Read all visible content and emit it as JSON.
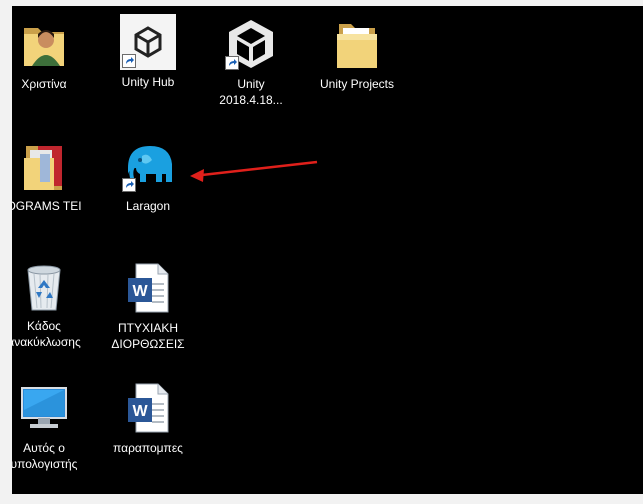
{
  "desktop": {
    "background_color": "#000000",
    "icons": [
      {
        "label": "Χριστίνα",
        "icon": "user-folder-icon"
      },
      {
        "label": "Unity Hub",
        "icon": "unity-hub-icon"
      },
      {
        "label": "Unity 2018.4.18...",
        "icon": "unity-editor-icon"
      },
      {
        "label": "Unity Projects",
        "icon": "folder-icon"
      },
      {
        "label": "OGRAMS TEI",
        "icon": "programs-folder-icon"
      },
      {
        "label": "Laragon",
        "icon": "laragon-elephant-icon"
      },
      {
        "label": "Κάδος ανακύκλωσης",
        "icon": "recycle-bin-icon"
      },
      {
        "label": "ΠΤΥΧΙΑΚΗ ΔΙΟΡΘΩΣΕΙΣ",
        "icon": "word-document-icon"
      },
      {
        "label": "Αυτός ο υπολογιστής",
        "icon": "this-pc-icon"
      },
      {
        "label": "παραπομπες",
        "icon": "word-document-icon"
      }
    ]
  },
  "annotation": {
    "type": "arrow",
    "color": "#e0201b",
    "points_to": "Laragon"
  },
  "colors": {
    "laragon_blue": "#1aa0e0",
    "word_blue": "#2b5797",
    "folder_yellow": "#e8c25a"
  }
}
